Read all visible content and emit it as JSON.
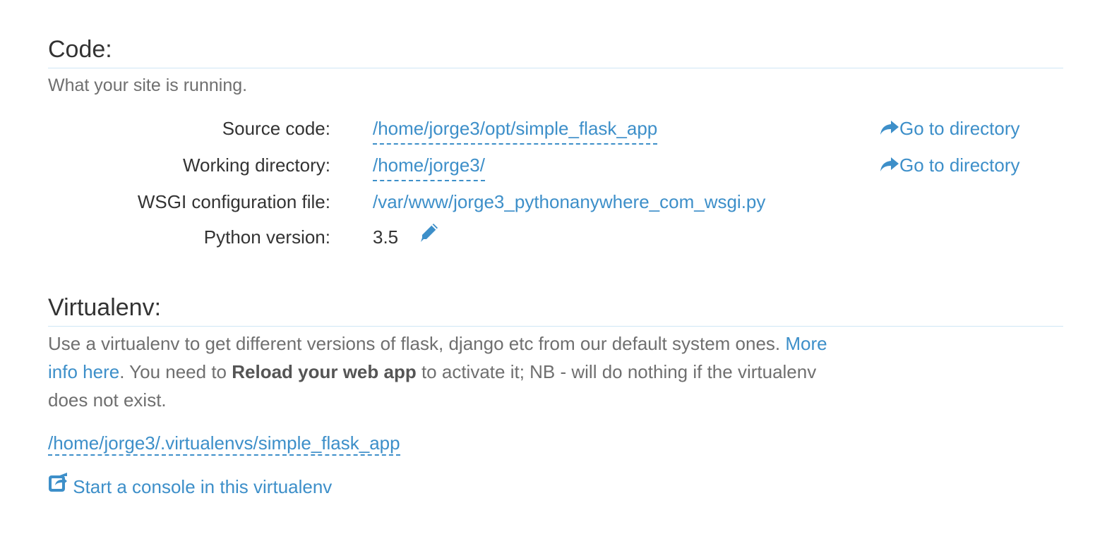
{
  "code_section": {
    "title": "Code:",
    "description": "What your site is running.",
    "rows": [
      {
        "label": "Source code:",
        "value": "/home/jorge3/opt/simple_flask_app",
        "goto": "Go to directory"
      },
      {
        "label": "Working directory:",
        "value": "/home/jorge3/",
        "goto": "Go to directory"
      },
      {
        "label": "WSGI configuration file:",
        "value": "/var/www/jorge3_pythonanywhere_com_wsgi.py"
      },
      {
        "label": "Python version:",
        "value": "3.5"
      }
    ]
  },
  "virtualenv_section": {
    "title": "Virtualenv:",
    "desc_part1": "Use a virtualenv to get different versions of flask, django etc from our default system ones. ",
    "more_info_link": "More info here",
    "desc_part2": ". You need to ",
    "reload_bold": "Reload your web app",
    "desc_part3": " to activate it; NB - will do nothing if the virtualenv does not exist.",
    "path": "/home/jorge3/.virtualenvs/simple_flask_app",
    "console_link": "Start a console in this virtualenv"
  },
  "icons": {
    "goto": "share-arrow-icon",
    "edit": "pencil-icon",
    "console": "external-link-icon"
  },
  "colors": {
    "link": "#3d8fc9",
    "divider": "#cfe6f5",
    "text": "#333333",
    "muted": "#6f6f6f"
  }
}
